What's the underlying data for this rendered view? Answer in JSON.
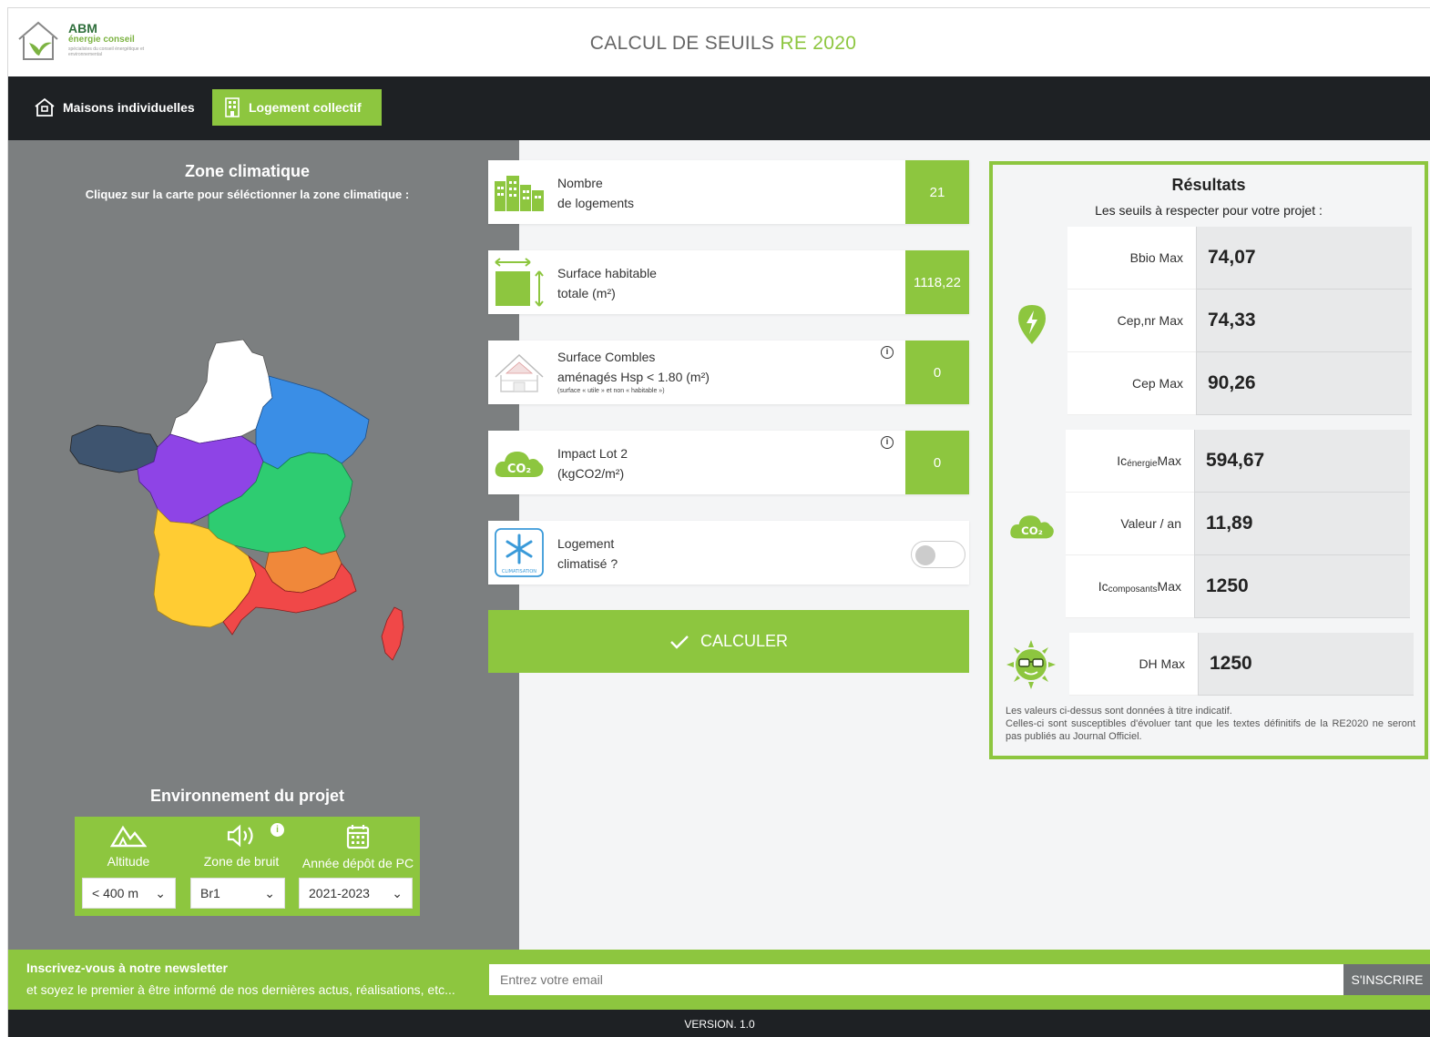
{
  "header": {
    "logo_name": "ABM",
    "logo_sub": "énergie conseil",
    "logo_tag": "spécialistes du conseil énergétique et environnemental",
    "title_main": "CALCUL DE SEUILS ",
    "title_accent": "RE 2020"
  },
  "nav": {
    "tab_houses": "Maisons individuelles",
    "tab_collective": "Logement collectif",
    "active": "Logement collectif"
  },
  "zone": {
    "title": "Zone climatique",
    "hint": "Cliquez sur la carte pour séléctionner la zone climatique :",
    "colors": {
      "H1a": "#ffffff",
      "H1b": "#3a8ee6",
      "H1c": "#2ecc71",
      "H2a": "#3e546f",
      "H2b": "#8e44e6",
      "H2c": "#ffcc33",
      "H2d": "#f0883a",
      "H3": "#f04848"
    }
  },
  "environment": {
    "title": "Environnement du projet",
    "altitude_label": "Altitude",
    "altitude_value": "< 400 m",
    "noise_label": "Zone de bruit",
    "noise_value": "Br1",
    "year_label": "Année dépôt de PC",
    "year_value": "2021-2023"
  },
  "inputs": {
    "logements_line1": "Nombre",
    "logements_line2": "de logements",
    "logements_value": "21",
    "surface_line1": "Surface habitable",
    "surface_line2": "totale (m²)",
    "surface_value": "1118,22",
    "combles_line1": "Surface Combles",
    "combles_line2": "aménagés Hsp < 1.80 (m²)",
    "combles_note": "(surface « utile » et non « habitable »)",
    "combles_value": "0",
    "lot2_line1": "Impact Lot 2",
    "lot2_line2": "(kgCO2/m²)",
    "lot2_value": "0",
    "clim_line1": "Logement",
    "clim_line2": "climatisé ?",
    "clim_badge": "CLIMATISATION",
    "clim_on": false,
    "calc_label": "CALCULER"
  },
  "results": {
    "title": "Résultats",
    "subtitle": "Les seuils à respecter pour votre projet :",
    "bbio_label": "Bbio Max",
    "bbio_value": "74,07",
    "cepnr_label": "Cep,nr Max",
    "cepnr_value": "74,33",
    "cep_label": "Cep Max",
    "cep_value": "90,26",
    "ic_energie_value": "594,67",
    "valeur_label": "Valeur / an",
    "valeur_value": "11,89",
    "ic_composants_value": "1250",
    "dh_label": "DH Max",
    "dh_value": "1250",
    "note_line1": "Les valeurs ci-dessus sont données à titre indicatif.",
    "note_line2": "Celles-ci sont susceptibles d'évoluer tant que les textes définitifs de la RE2020 ne seront pas publiés au Journal Officiel."
  },
  "newsletter": {
    "title": "Inscrivez-vous à notre newsletter",
    "text": "et soyez le premier à être informé de nos dernières actus, réalisations, etc...",
    "placeholder": "Entrez votre email",
    "button": "S'INSCRIRE"
  },
  "footer": {
    "version": "VERSION. 1.0"
  },
  "theme": {
    "accent": "#8dc63f",
    "dark": "#1e2124",
    "panel_grey": "#7c7f80"
  }
}
